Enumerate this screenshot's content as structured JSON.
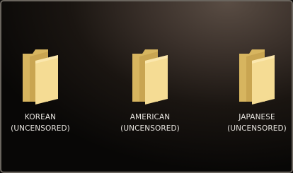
{
  "desktop": {
    "folders": [
      {
        "icon": "folder-icon",
        "line1": "KOREAN",
        "line2": "(UNCENSORED)"
      },
      {
        "icon": "folder-icon",
        "line1": "AMERICAN",
        "line2": "(UNCENSORED)"
      },
      {
        "icon": "folder-icon",
        "line1": "JAPANESE",
        "line2": "(UNCENSORED)"
      }
    ]
  },
  "colors": {
    "folder_front": "#f3d98f",
    "folder_back": "#d9b863",
    "label_text": "#e9e6e1",
    "background_dark": "#0b0908"
  }
}
